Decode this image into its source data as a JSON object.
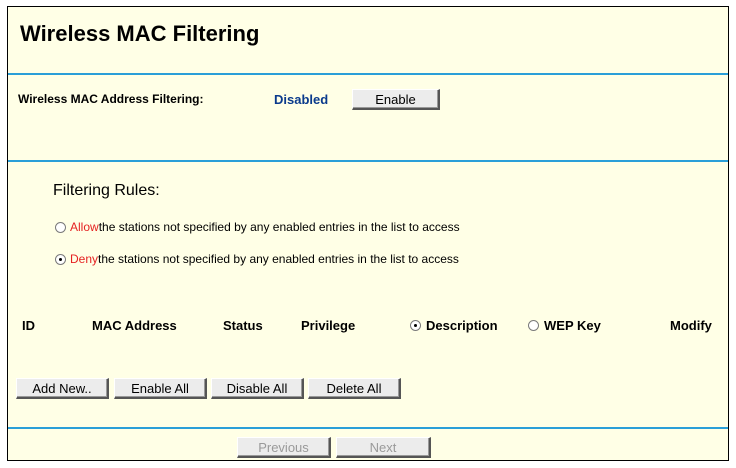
{
  "page": {
    "title": "Wireless MAC Filtering"
  },
  "status": {
    "label": "Wireless MAC Address Filtering:",
    "value": "Disabled",
    "enable_label": "Enable"
  },
  "rules": {
    "heading": "Filtering Rules:",
    "options": [
      {
        "keyword": "Allow",
        "text": " the stations not specified by any enabled entries in the list to access",
        "selected": false
      },
      {
        "keyword": "Deny",
        "text": " the stations not specified by any enabled entries in the list to access",
        "selected": true
      }
    ]
  },
  "table": {
    "headers": {
      "id": "ID",
      "mac": "MAC Address",
      "status": "Status",
      "privilege": "Privilege",
      "description": "Description",
      "wep_key": "WEP Key",
      "modify": "Modify"
    },
    "display_mode": "Description"
  },
  "actions": {
    "add_new": "Add New..",
    "enable_all": "Enable All",
    "disable_all": "Disable All",
    "delete_all": "Delete All"
  },
  "pager": {
    "previous": "Previous",
    "next": "Next"
  },
  "colors": {
    "background": "#ffffe6",
    "divider": "#2a9fd8",
    "status_value": "#0a3a8c",
    "keyword": "#e52222"
  }
}
